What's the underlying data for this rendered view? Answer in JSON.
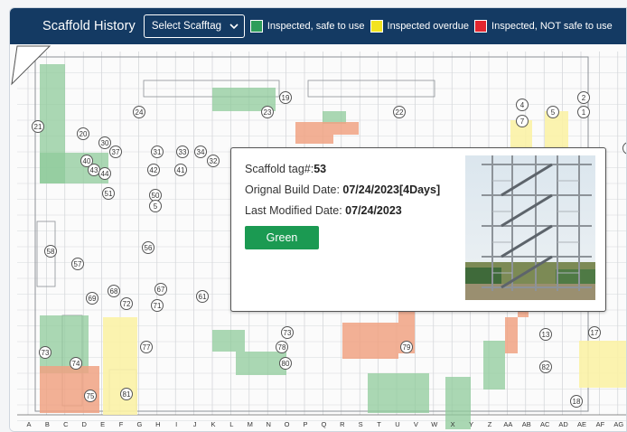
{
  "header": {
    "title": "Scaffold History",
    "select_label": "Select Scafftag",
    "legend": [
      {
        "label": "Inspected, safe to use",
        "color": "#2e9d5a"
      },
      {
        "label": "Inspected overdue",
        "color": "#f3e320"
      },
      {
        "label": "Inspected, NOT safe to use",
        "color": "#e2262f"
      }
    ]
  },
  "popup": {
    "tag_label": "Scaffold tag#:",
    "tag_value": "53",
    "build_label": "Orignal Build Date: ",
    "build_value": "07/24/2023[4Days]",
    "modified_label": "Last Modified Date: ",
    "modified_value": "07/24/2023",
    "status_button": "Green"
  },
  "map": {
    "columns": [
      "A",
      "B",
      "C",
      "D",
      "E",
      "F",
      "G",
      "H",
      "I",
      "J",
      "K",
      "L",
      "M",
      "N",
      "O",
      "P",
      "Q",
      "R",
      "S",
      "T",
      "U",
      "V",
      "W",
      "X",
      "Y",
      "Z",
      "AA",
      "AB",
      "AC",
      "AD",
      "AE",
      "AF",
      "AG"
    ],
    "markers": [
      "19",
      "24",
      "23",
      "22",
      "2",
      "1",
      "4",
      "5",
      "7",
      "21",
      "20",
      "30",
      "37",
      "31",
      "33",
      "34",
      "32",
      "3",
      "40",
      "43",
      "44",
      "42",
      "41",
      "51",
      "50",
      "5",
      "58",
      "56",
      "57",
      "68",
      "67",
      "61",
      "69",
      "72",
      "71",
      "73",
      "77",
      "74",
      "75",
      "81",
      "73",
      "78",
      "80",
      "79",
      "13",
      "17",
      "82",
      "18"
    ]
  },
  "colors": {
    "header_bg": "#143a63",
    "green_zone": "#8fcb9b",
    "yellow_zone": "#fbf2a6",
    "red_zone": "#f0a283",
    "button_green": "#1b9a52"
  }
}
